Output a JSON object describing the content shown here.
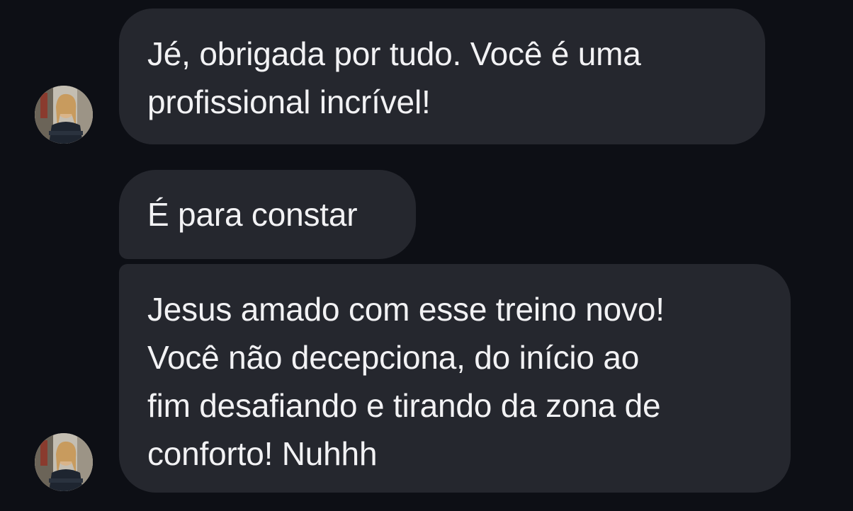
{
  "conversation": {
    "messages": [
      {
        "lines": [
          "Jé, obrigada por tudo. Você é uma",
          "profissional incrível!"
        ]
      },
      {
        "lines": [
          "É para constar"
        ]
      },
      {
        "lines": [
          "Jesus amado com esse treino novo!",
          "Você não decepciona, do início ao",
          "fim desafiando e tirando da zona de",
          "conforto! Nuhhh"
        ]
      }
    ],
    "avatar_icon": "user-photo-avatar"
  }
}
